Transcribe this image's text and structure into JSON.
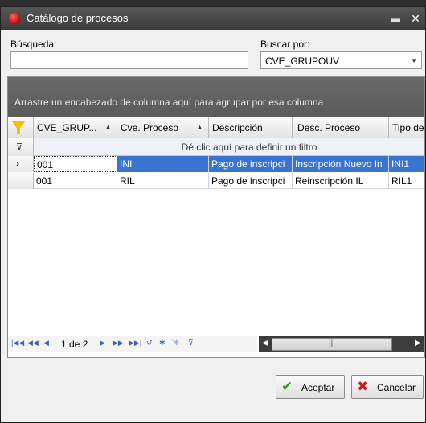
{
  "window": {
    "title": "Catálogo de procesos",
    "min_glyph": "▬",
    "close_glyph": "✕"
  },
  "search": {
    "label": "Búsqueda:",
    "value": "",
    "placeholder": ""
  },
  "search_by": {
    "label": "Buscar por:",
    "selected": "CVE_GRUPOUV"
  },
  "grid": {
    "group_panel_text": "Arrastre un encabezado de columna aquí para agrupar por esa columna",
    "columns": [
      {
        "label": "CVE_GRUP...",
        "sort": "▲"
      },
      {
        "label": "Cve. Proceso",
        "sort": "▲"
      },
      {
        "label": "Descripción",
        "sort": ""
      },
      {
        "label": "Desc. Proceso",
        "sort": ""
      },
      {
        "label": "Tipo de",
        "sort": ""
      }
    ],
    "filter_row_text": "Dé clic aquí para definir un filtro",
    "rows": [
      {
        "indicator": "›",
        "cells": [
          "001",
          "INI",
          "Pago de inscripci",
          "Inscripción Nuevo In",
          "INI1"
        ]
      },
      {
        "indicator": "",
        "cells": [
          "001",
          "RIL",
          "Pago de inscripci",
          "Reinscripción IL",
          "RIL1"
        ]
      }
    ]
  },
  "navigator": {
    "page_text": "1 de 2"
  },
  "buttons": {
    "accept": "Aceptar",
    "cancel": "Cancelar"
  },
  "colors": {
    "selection": "#3874d0",
    "titlebar": "#4a4a4a",
    "group_panel": "#626262"
  }
}
